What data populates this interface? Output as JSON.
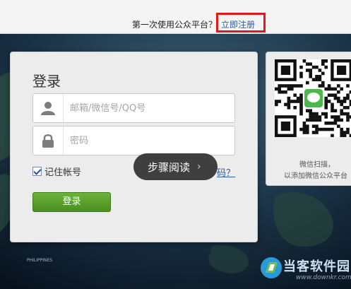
{
  "topbar": {
    "prompt_text": "第一次使用公众平台？",
    "register_link": "立即注册",
    "highlight_color": "#e01a1a"
  },
  "login": {
    "title": "登录",
    "username_placeholder": "邮箱/微信号/QQ号",
    "password_placeholder": "密码",
    "remember_label": "记住帐号",
    "remember_checked": true,
    "forgot_link": "码？",
    "button_label": "登录",
    "button_color": "#5aa02c"
  },
  "step_reading": {
    "label": "步骤阅读",
    "chevron": "›"
  },
  "qr": {
    "caption_line1": "微信扫描，",
    "caption_line2": "以添加微信公众平台"
  },
  "map_label": "PHILIPPINES",
  "watermark": {
    "title": "当客软件园",
    "url": "www.downkr.com"
  },
  "icons": [
    "user-icon",
    "lock-icon",
    "checkbox-check-icon",
    "chevron-right-icon",
    "wechat-icon"
  ]
}
